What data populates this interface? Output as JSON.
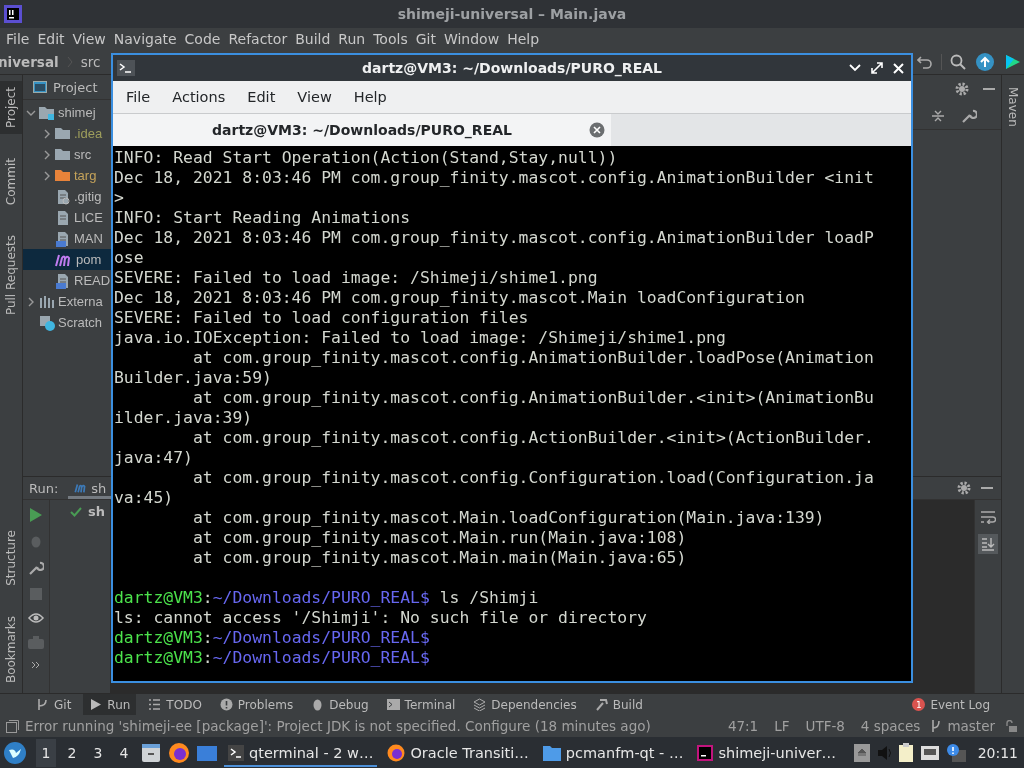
{
  "ide": {
    "title": "shimeji-universal – Main.java",
    "menu": [
      "File",
      "Edit",
      "View",
      "Navigate",
      "Code",
      "Refactor",
      "Build",
      "Run",
      "Tools",
      "Git",
      "Window",
      "Help"
    ],
    "breadcrumbs": [
      "niversal",
      "src"
    ],
    "left_tool_tabs_top": [
      {
        "label": "Project",
        "selected": true
      },
      {
        "label": "Commit",
        "selected": false
      },
      {
        "label": "Pull Requests",
        "selected": false
      }
    ],
    "left_tool_tabs_bottom": [
      {
        "label": "Structure",
        "selected": false
      },
      {
        "label": "Bookmarks",
        "selected": false
      }
    ],
    "right_tool_tabs": [
      {
        "label": "Maven",
        "selected": false
      }
    ],
    "project": {
      "title": "Project",
      "tree": [
        {
          "label": "shimej",
          "kind": "module",
          "expanded": true,
          "selected": false,
          "children": [
            {
              "label": ".idea",
              "kind": "folder-ignored",
              "expanded": false,
              "selected": false
            },
            {
              "label": "src",
              "kind": "folder",
              "expanded": false,
              "selected": false
            },
            {
              "label": "targ",
              "kind": "folder-excluded",
              "expanded": false,
              "selected": false
            },
            {
              "label": ".gitig",
              "kind": "file-ignore",
              "selected": false
            },
            {
              "label": "LICE",
              "kind": "file-text",
              "selected": false
            },
            {
              "label": "MAN",
              "kind": "file-mf",
              "selected": false
            },
            {
              "label": "pom",
              "kind": "maven",
              "selected": true
            },
            {
              "label": "READ",
              "kind": "file-md",
              "selected": false
            }
          ]
        },
        {
          "label": "Externa",
          "kind": "library",
          "expanded": false,
          "selected": false
        },
        {
          "label": "Scratch",
          "kind": "scratch",
          "selected": false
        }
      ]
    },
    "run": {
      "title": "Run:",
      "tab": {
        "label": "sh",
        "selected": true
      },
      "tree": [
        {
          "label": "sh",
          "passed": true
        }
      ]
    },
    "tool_windows": [
      {
        "label": "Git",
        "kind": "git",
        "selected": false
      },
      {
        "label": "Run",
        "kind": "run",
        "selected": true
      },
      {
        "label": "TODO",
        "kind": "todo",
        "selected": false
      },
      {
        "label": "Problems",
        "kind": "problems",
        "selected": false
      },
      {
        "label": "Debug",
        "kind": "debug",
        "selected": false
      },
      {
        "label": "Terminal",
        "kind": "terminal",
        "selected": false
      },
      {
        "label": "Dependencies",
        "kind": "dependencies",
        "selected": false
      },
      {
        "label": "Build",
        "kind": "build",
        "selected": false
      }
    ],
    "event_log": {
      "label": "Event Log",
      "badge": "1"
    },
    "status_bar": {
      "message": "Error running 'shimeji-ee [package]': Project JDK is not specified. Configure (18 minutes ago)",
      "position": "47:1",
      "line_separator": "LF",
      "encoding": "UTF-8",
      "indent": "4 spaces",
      "branch": "master"
    }
  },
  "terminal": {
    "title": "dartz@VM3: ~/Downloads/PURO_REAL",
    "menu": [
      "File",
      "Actions",
      "Edit",
      "View",
      "Help"
    ],
    "tab": {
      "label": "dartz@VM3: ~/Downloads/PURO_REAL",
      "selected": true
    },
    "lines": [
      {
        "kind": "text",
        "text": "INFO: Read Start Operation(Action(Stand,Stay,null))"
      },
      {
        "kind": "text",
        "text": "Dec 18, 2021 8:03:46 PM com.group_finity.mascot.config.AnimationBuilder <init"
      },
      {
        "kind": "text",
        "text": ">"
      },
      {
        "kind": "text",
        "text": "INFO: Start Reading Animations"
      },
      {
        "kind": "text",
        "text": "Dec 18, 2021 8:03:46 PM com.group_finity.mascot.config.AnimationBuilder loadP"
      },
      {
        "kind": "text",
        "text": "ose"
      },
      {
        "kind": "text",
        "text": "SEVERE: Failed to load image: /Shimeji/shime1.png"
      },
      {
        "kind": "text",
        "text": "Dec 18, 2021 8:03:46 PM com.group_finity.mascot.Main loadConfiguration"
      },
      {
        "kind": "text",
        "text": "SEVERE: Failed to load configuration files"
      },
      {
        "kind": "text",
        "text": "java.io.IOException: Failed to load image: /Shimeji/shime1.png"
      },
      {
        "kind": "trace",
        "text": "at com.group_finity.mascot.config.AnimationBuilder.loadPose(Animation"
      },
      {
        "kind": "text",
        "text": "Builder.java:59)"
      },
      {
        "kind": "trace",
        "text": "at com.group_finity.mascot.config.AnimationBuilder.<init>(AnimationBu"
      },
      {
        "kind": "text",
        "text": "ilder.java:39)"
      },
      {
        "kind": "trace",
        "text": "at com.group_finity.mascot.config.ActionBuilder.<init>(ActionBuilder."
      },
      {
        "kind": "text",
        "text": "java:47)"
      },
      {
        "kind": "trace",
        "text": "at com.group_finity.mascot.config.Configuration.load(Configuration.ja"
      },
      {
        "kind": "text",
        "text": "va:45)"
      },
      {
        "kind": "trace",
        "text": "at com.group_finity.mascot.Main.loadConfiguration(Main.java:139)"
      },
      {
        "kind": "trace",
        "text": "at com.group_finity.mascot.Main.run(Main.java:108)"
      },
      {
        "kind": "trace",
        "text": "at com.group_finity.mascot.Main.main(Main.java:65)"
      },
      {
        "kind": "blank"
      },
      {
        "kind": "prompt",
        "user": "dartz@VM3",
        "sep": ":",
        "path": "~/Downloads/PURO_REAL$",
        "command": "ls /Shimji"
      },
      {
        "kind": "text",
        "text": "ls: cannot access '/Shimji': No such file or directory"
      },
      {
        "kind": "prompt",
        "user": "dartz@VM3",
        "sep": ":",
        "path": "~/Downloads/PURO_REAL$"
      },
      {
        "kind": "prompt",
        "user": "dartz@VM3",
        "sep": ":",
        "path": "~/Downloads/PURO_REAL$"
      }
    ]
  },
  "taskbar": {
    "workspaces": [
      {
        "label": "1",
        "selected": true
      },
      {
        "label": "2",
        "selected": false
      },
      {
        "label": "3",
        "selected": false
      },
      {
        "label": "4",
        "selected": false
      }
    ],
    "tasks": [
      {
        "label": "qterminal - 2 w…",
        "kind": "terminal",
        "selected": true
      },
      {
        "label": "Oracle Transiti…",
        "kind": "browser",
        "selected": false
      },
      {
        "label": "pcmanfm-qt - …",
        "kind": "files",
        "selected": false
      },
      {
        "label": "shimeji-univer…",
        "kind": "ide",
        "selected": false
      }
    ],
    "clock": "20:11"
  }
}
